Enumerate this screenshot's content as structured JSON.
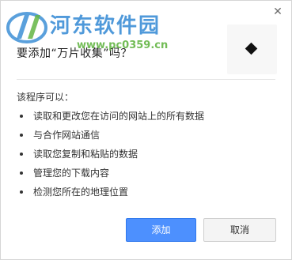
{
  "dialog": {
    "close_icon": "close-icon",
    "title": "要添加“万片收集”吗？",
    "extension_icon": "diamond-icon",
    "permissions_heading": "该程序可以：",
    "permissions": [
      "读取和更改您在访问的网站上的所有数据",
      "与合作网站通信",
      "读取您复制和粘贴的数据",
      "管理您的下载内容",
      "检测您所在的地理位置"
    ],
    "add_label": "添加",
    "cancel_label": "取消"
  },
  "watermark": {
    "brand": "河东软件园",
    "url": "www.pc0359.cn"
  },
  "colors": {
    "primary_button": "#4d90fe",
    "watermark_text": "#3d8fd6",
    "watermark_url": "#63b544"
  }
}
